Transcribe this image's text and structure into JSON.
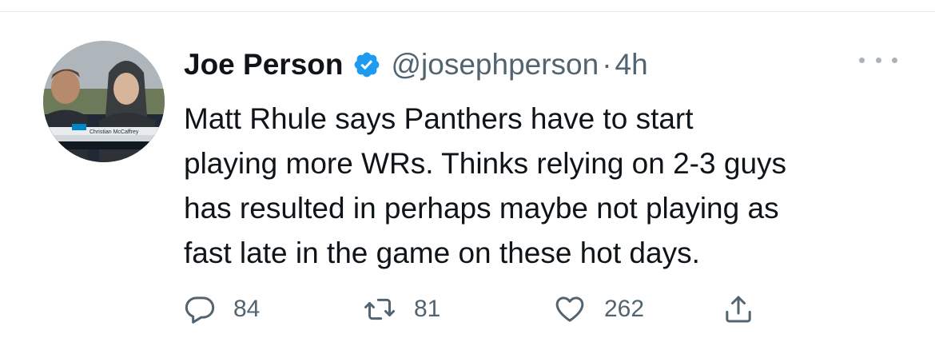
{
  "tweet": {
    "author": {
      "display_name": "Joe Person",
      "handle": "@josephperson",
      "verified": true
    },
    "separator": "·",
    "time": "4h",
    "text_lines": [
      "Matt Rhule says Panthers have to start",
      "playing more WRs. Thinks relying on 2-3 guys",
      "has resulted in perhaps maybe not playing as",
      "fast late in the game on these hot days."
    ],
    "avatar_caption": "Christian McCaffrey",
    "actions": {
      "reply": {
        "icon": "reply-icon",
        "count": "84"
      },
      "retweet": {
        "icon": "retweet-icon",
        "count": "81"
      },
      "like": {
        "icon": "heart-icon",
        "count": "262"
      },
      "share": {
        "icon": "share-icon"
      }
    },
    "more_icon": "more-icon"
  },
  "colors": {
    "text": "#0f1419",
    "secondary": "#536471",
    "verified_blue": "#1d9bf0"
  }
}
